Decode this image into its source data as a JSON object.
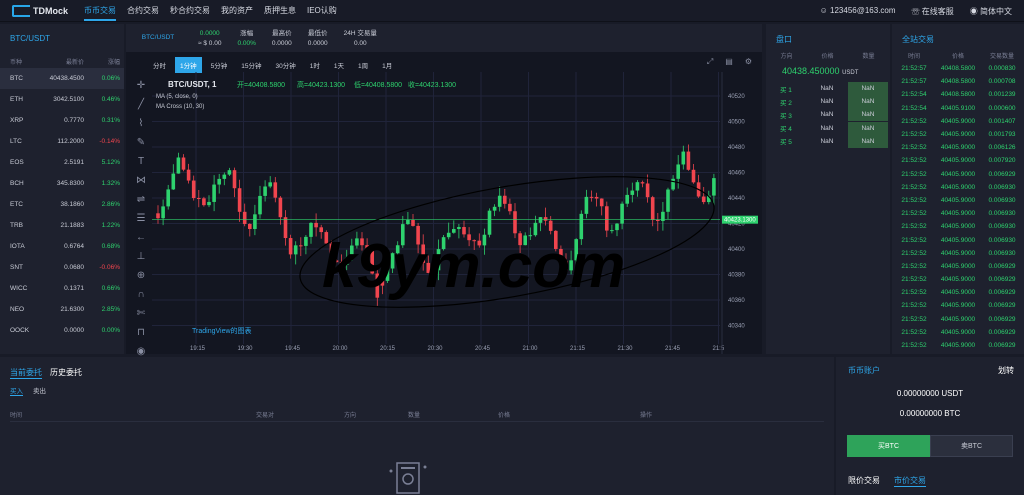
{
  "brand": "TDMock",
  "nav": [
    "币币交易",
    "合约交易",
    "秒合约交易",
    "我的资产",
    "质押生息",
    "IEO认购"
  ],
  "user": {
    "email": "123456@163.com",
    "service": "在线客服",
    "lang": "简体中文"
  },
  "market": {
    "title": "BTC/USDT",
    "cols": [
      "币种",
      "最新价",
      "涨幅"
    ],
    "rows": [
      [
        "BTC",
        "40438.4500",
        "0.06%",
        "g"
      ],
      [
        "ETH",
        "3042.5100",
        "0.46%",
        "g"
      ],
      [
        "XRP",
        "0.7770",
        "0.31%",
        "g"
      ],
      [
        "LTC",
        "112.2000",
        "-0.14%",
        "r"
      ],
      [
        "EOS",
        "2.5191",
        "5.12%",
        "g"
      ],
      [
        "BCH",
        "345.8300",
        "1.32%",
        "g"
      ],
      [
        "ETC",
        "38.1860",
        "2.86%",
        "g"
      ],
      [
        "TRB",
        "21.1883",
        "1.22%",
        "g"
      ],
      [
        "IOTA",
        "0.6764",
        "0.68%",
        "g"
      ],
      [
        "SNT",
        "0.0680",
        "-0.06%",
        "r"
      ],
      [
        "WICC",
        "0.1371",
        "0.66%",
        "g"
      ],
      [
        "NEO",
        "21.6300",
        "2.85%",
        "g"
      ],
      [
        "OOCK",
        "0.0000",
        "0.00%",
        "g"
      ]
    ]
  },
  "ticker": {
    "pair": "BTC/USDT",
    "price": "0.0000",
    "cny": "≈ $ 0.00",
    "labels": [
      "涨幅",
      "最高价",
      "最低价",
      "24H 交易量"
    ],
    "values": [
      "0.00%",
      "0.0000",
      "0.0000",
      "0.00"
    ]
  },
  "intervals": [
    "分时",
    "1分钟",
    "5分钟",
    "15分钟",
    "30分钟",
    "1时",
    "1天",
    "1周",
    "1月"
  ],
  "chartinfo": {
    "line1": "BTC/USDT, 1",
    "open": "开=40408.5800",
    "high": "高=40423.1300",
    "low": "低=40408.5800",
    "close": "收=40423.1300",
    "ma1": "MA (5, close, 0)",
    "ma2": "MA Cross (10, 30)",
    "tv": "TradingView的图表",
    "last": "40423.1300",
    "watermark": "k9ym.com"
  },
  "chart_data": {
    "type": "line",
    "yticks": [
      40520,
      40500,
      40480,
      40460,
      40440,
      40420,
      40400,
      40380,
      40360,
      40340
    ],
    "xticks": [
      "19:15",
      "19:30",
      "19:45",
      "20:00",
      "20:15",
      "20:30",
      "20:45",
      "21:00",
      "21:15",
      "21:30",
      "21:45",
      "21:5"
    ]
  },
  "orderbook": {
    "title": "盘口",
    "cols": [
      "方向",
      "价格",
      "数量"
    ],
    "price": "40438.450000",
    "unit": "USDT",
    "rows": [
      [
        "买 1",
        "NaN",
        "NaN"
      ],
      [
        "买 2",
        "NaN",
        "NaN"
      ],
      [
        "买 3",
        "NaN",
        "NaN"
      ],
      [
        "买 4",
        "NaN",
        "NaN"
      ],
      [
        "买 5",
        "NaN",
        "NaN"
      ]
    ]
  },
  "trades": {
    "title": "全站交易",
    "cols": [
      "时间",
      "价格",
      "交易数量"
    ],
    "rows": [
      [
        "21:52:57",
        "40408.5800",
        "0.000830"
      ],
      [
        "21:52:57",
        "40408.5800",
        "0.000708"
      ],
      [
        "21:52:54",
        "40408.5800",
        "0.001239"
      ],
      [
        "21:52:54",
        "40405.9100",
        "0.000600"
      ],
      [
        "21:52:52",
        "40405.9000",
        "0.001407"
      ],
      [
        "21:52:52",
        "40405.9000",
        "0.001793"
      ],
      [
        "21:52:52",
        "40405.9000",
        "0.006126"
      ],
      [
        "21:52:52",
        "40405.9000",
        "0.007920"
      ],
      [
        "21:52:52",
        "40405.9000",
        "0.006929"
      ],
      [
        "21:52:52",
        "40405.9000",
        "0.006930"
      ],
      [
        "21:52:52",
        "40405.9000",
        "0.006930"
      ],
      [
        "21:52:52",
        "40405.9000",
        "0.006930"
      ],
      [
        "21:52:52",
        "40405.9000",
        "0.006930"
      ],
      [
        "21:52:52",
        "40405.9000",
        "0.006930"
      ],
      [
        "21:52:52",
        "40405.9000",
        "0.006930"
      ],
      [
        "21:52:52",
        "40405.9000",
        "0.006929"
      ],
      [
        "21:52:52",
        "40405.9000",
        "0.006929"
      ],
      [
        "21:52:52",
        "40405.9000",
        "0.006929"
      ],
      [
        "21:52:52",
        "40405.9000",
        "0.006929"
      ],
      [
        "21:52:52",
        "40405.9000",
        "0.006929"
      ],
      [
        "21:52:52",
        "40405.9000",
        "0.006929"
      ],
      [
        "21:52:52",
        "40405.9000",
        "0.006929"
      ]
    ]
  },
  "orders": {
    "tabs": [
      "当前委托",
      "历史委托"
    ],
    "sub": [
      "买入",
      "卖出"
    ],
    "cols": [
      "时间",
      "交易对",
      "方向",
      "数量",
      "价格",
      "操作"
    ]
  },
  "assets": {
    "title": "币币账户",
    "transfer": "划转",
    "usdt": "0.00000000 USDT",
    "btc": "0.00000000 BTC",
    "buy": "买BTC",
    "sell": "卖BTC",
    "limit": "限价交易",
    "market": "市价交易"
  }
}
